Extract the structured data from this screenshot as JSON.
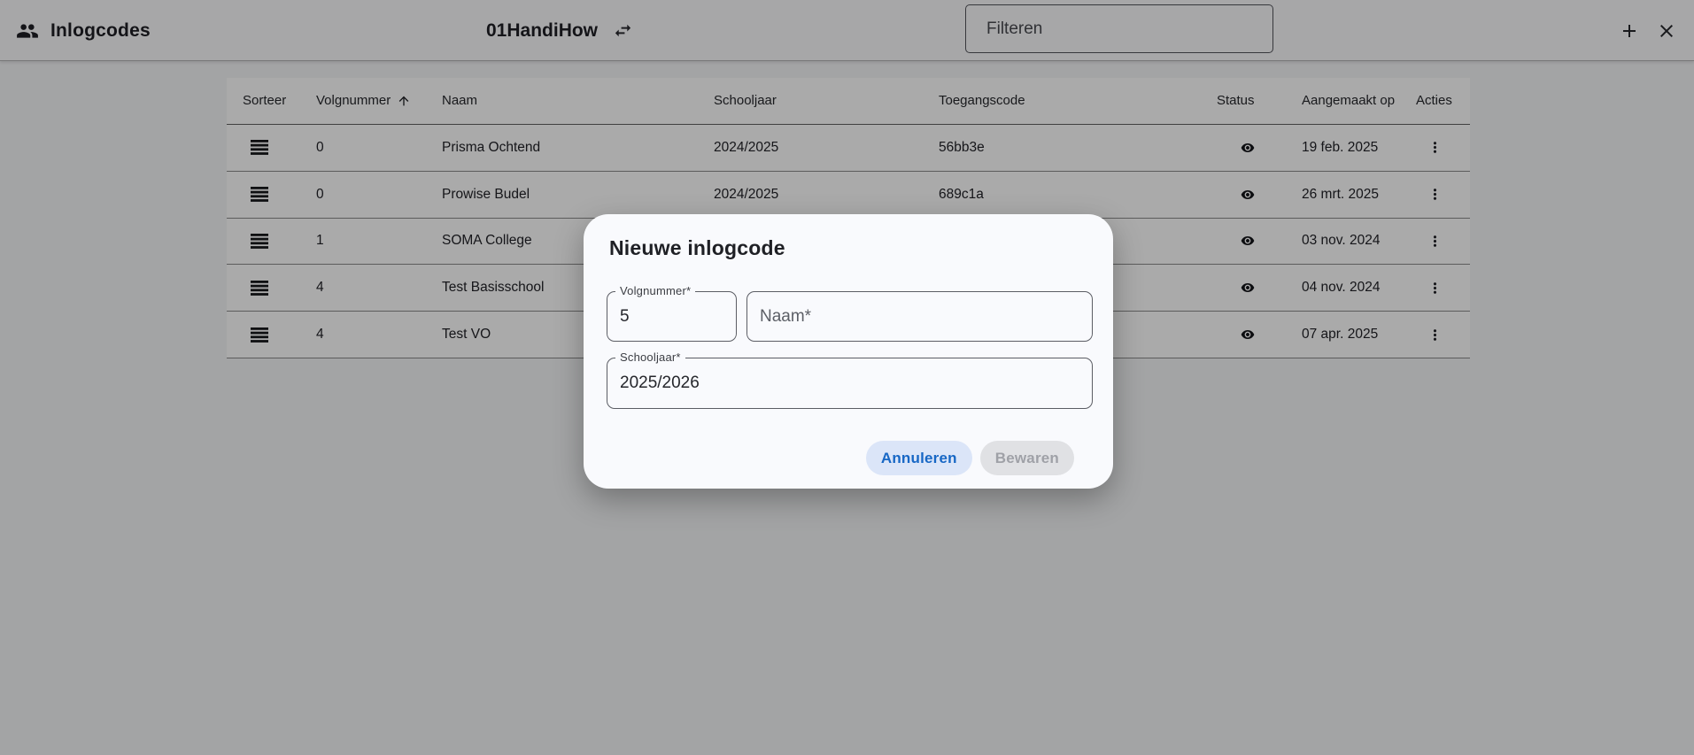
{
  "header": {
    "title": "Inlogcodes",
    "context_title": "01HandiHow",
    "filter_placeholder": "Filteren",
    "icons": {
      "app": "people-icon",
      "context_switch": "swap-horizontal-icon",
      "add": "plus-icon",
      "close": "close-icon"
    }
  },
  "table": {
    "columns": [
      "Sorteer",
      "Volgnummer",
      "Naam",
      "Schooljaar",
      "Toegangscode",
      "Status",
      "Aangemaakt op",
      "Acties"
    ],
    "sorted_by": "Volgnummer",
    "sort_direction": "asc",
    "row_icons": {
      "drag": "drag-handle-icon",
      "status": "eye-icon",
      "actions": "more-vert-icon"
    },
    "rows": [
      {
        "volgnummer": "0",
        "naam": "Prisma Ochtend",
        "schooljaar": "2024/2025",
        "toegangscode": "56bb3e",
        "aangemaakt_op": "19 feb. 2025"
      },
      {
        "volgnummer": "0",
        "naam": "Prowise Budel",
        "schooljaar": "2024/2025",
        "toegangscode": "689c1a",
        "aangemaakt_op": "26 mrt. 2025"
      },
      {
        "volgnummer": "1",
        "naam": "SOMA College",
        "schooljaar": "",
        "toegangscode": "",
        "aangemaakt_op": "03 nov. 2024"
      },
      {
        "volgnummer": "4",
        "naam": "Test Basisschool",
        "schooljaar": "",
        "toegangscode": "",
        "aangemaakt_op": "04 nov. 2024"
      },
      {
        "volgnummer": "4",
        "naam": "Test VO",
        "schooljaar": "",
        "toegangscode": "",
        "aangemaakt_op": "07 apr. 2025"
      }
    ]
  },
  "dialog": {
    "title": "Nieuwe inlogcode",
    "fields": {
      "volgnummer": {
        "label": "Volgnummer*",
        "value": "5"
      },
      "naam": {
        "label": "Naam*",
        "value": ""
      },
      "schooljaar": {
        "label": "Schooljaar*",
        "value": "2025/2026"
      }
    },
    "buttons": {
      "cancel": "Annuleren",
      "save": "Bewaren"
    },
    "save_disabled": true
  },
  "colors": {
    "accent_blue": "#1767c5",
    "cancel_button_bg": "#dbe5f8",
    "disabled_button_bg": "#e0e1e4",
    "disabled_button_text": "#9fa1a7",
    "dialog_bg": "#f9fafd",
    "overlay": "rgba(0,0,0,0.335)"
  }
}
